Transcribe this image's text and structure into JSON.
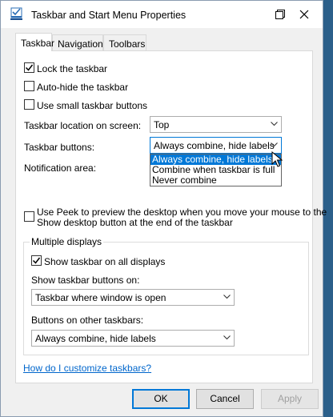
{
  "window": {
    "title": "Taskbar and Start Menu Properties"
  },
  "tabs": [
    {
      "label": "Taskbar",
      "active": true
    },
    {
      "label": "Navigation",
      "active": false
    },
    {
      "label": "Toolbars",
      "active": false
    }
  ],
  "taskbar": {
    "lock_label": "Lock the taskbar",
    "lock_checked": true,
    "autohide_label": "Auto-hide the taskbar",
    "autohide_checked": false,
    "small_buttons_label": "Use small taskbar buttons",
    "small_buttons_checked": false,
    "location_label": "Taskbar location on screen:",
    "location_value": "Top",
    "buttons_label": "Taskbar buttons:",
    "buttons_value": "Always combine, hide labels",
    "buttons_options": [
      "Always combine, hide labels",
      "Combine when taskbar is full",
      "Never combine"
    ],
    "notification_label": "Notification area:",
    "peek_label_line1": "Use Peek to preview the desktop when you move your mouse to the",
    "peek_label_line2": "Show desktop button at the end of the taskbar",
    "peek_checked": false
  },
  "multiple_displays": {
    "group_title": "Multiple displays",
    "show_all_label": "Show taskbar on all displays",
    "show_all_checked": true,
    "show_buttons_on_label": "Show taskbar buttons on:",
    "show_buttons_on_value": "Taskbar where window is open",
    "other_buttons_label": "Buttons on other taskbars:",
    "other_buttons_value": "Always combine, hide labels"
  },
  "help_link": "How do I customize taskbars?",
  "buttons": {
    "ok": "OK",
    "cancel": "Cancel",
    "apply": "Apply"
  },
  "colors": {
    "accent": "#0078d7",
    "link": "#0066cc"
  }
}
